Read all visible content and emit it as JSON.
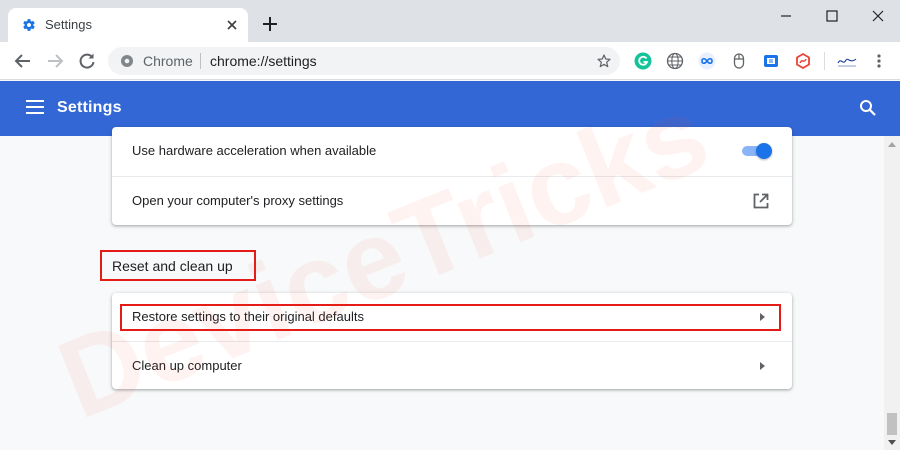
{
  "browser": {
    "tab_title": "Settings",
    "site_name": "Chrome",
    "url": "chrome://settings"
  },
  "header": {
    "title": "Settings"
  },
  "advanced_card": {
    "rows": [
      {
        "label": "Use hardware acceleration when available",
        "control": "toggle",
        "enabled": true
      },
      {
        "label": "Open your computer's proxy settings",
        "control": "launch-icon"
      }
    ]
  },
  "reset_section": {
    "title": "Reset and clean up",
    "rows": [
      {
        "label": "Restore settings to their original defaults",
        "control": "arrow-right-icon"
      },
      {
        "label": "Clean up computer",
        "control": "arrow-right-icon"
      }
    ]
  },
  "watermark": "DeviceTricks",
  "colors": {
    "header_blue": "#3367d6",
    "highlight_red": "#e41b17",
    "toggle_blue": "#1a73e8"
  },
  "icons": [
    "settings-gear-icon",
    "close-icon",
    "plus-icon",
    "minimize-icon",
    "maximize-icon",
    "back-icon",
    "forward-icon",
    "reload-icon",
    "star-icon",
    "grammarly-icon",
    "globe-icon",
    "infinity-icon",
    "mouse-icon",
    "extension-icon",
    "speedcurve-icon",
    "menu-icon",
    "search-icon"
  ]
}
